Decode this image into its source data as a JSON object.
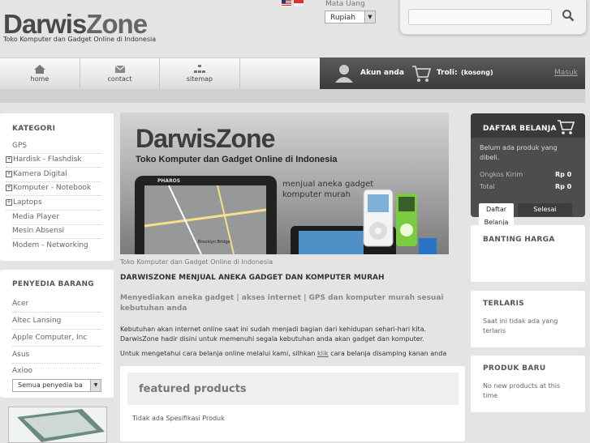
{
  "header": {
    "logo_part1": "Darwis",
    "logo_part2": "Zone",
    "tagline": "Toko Komputer dan Gadget Online di Indonesia",
    "currency_label": "Mata Uang",
    "currency_value": "Rupiah"
  },
  "nav": {
    "items": [
      {
        "label": "home"
      },
      {
        "label": "contact"
      },
      {
        "label": "sitemap"
      }
    ],
    "account_label": "Akun anda",
    "cart_label": "Troli:",
    "cart_value": "(kosong)",
    "login_label": "Masuk"
  },
  "categories": {
    "title": "KATEGORI",
    "items": [
      {
        "label": "GPS",
        "expandable": false
      },
      {
        "label": "Hardisk - Flashdisk",
        "expandable": true
      },
      {
        "label": "Kamera Digital",
        "expandable": true
      },
      {
        "label": "Komputer - Notebook",
        "expandable": true
      },
      {
        "label": "Laptops",
        "expandable": true
      },
      {
        "label": "Media Player",
        "expandable": false
      },
      {
        "label": "Mesin Absensi",
        "expandable": false
      },
      {
        "label": "Modem - Networking",
        "expandable": false
      }
    ]
  },
  "suppliers": {
    "title": "PENYEDIA BARANG",
    "items": [
      "Acer",
      "Altec Lansing",
      "Apple Computer, Inc",
      "Asus",
      "Axioo"
    ],
    "select_value": "Semua penyedia ba"
  },
  "banner": {
    "logo": "DarwisZone",
    "headline": "Toko Komputer dan Gadget Online di Indonesia",
    "tagline_line1": "menjual aneka gadget",
    "tagline_line2": "komputer murah",
    "device_brand": "PHAROS",
    "map_label": "Brooklyn Bridge"
  },
  "main": {
    "caption": "Toko Komputer dan Gadget Online di Indonesia",
    "heading": "DARWISZONE MENJUAL ANEKA GADGET DAN KOMPUTER MURAH",
    "subheading": "Menyediakan aneka gadget | akses internet | GPS dan komputer murah sesuai kebutuhan anda",
    "paragraph1": "Kebutuhan akan internet online saat ini sudah menjadi bagian dari kehidupan sehari-hari kita. DarwisZone hadir disini untuk memenuhi segala kebutuhan anda akan gadget dan komputer.",
    "paragraph2_before": "Untuk mengetahui cara belanja online melalui kami, silhkan ",
    "paragraph2_link": "klik",
    "paragraph2_after": " cara belanja disamping kanan anda",
    "featured_title": "featured products",
    "featured_empty": "Tidak ada Spesifikasi Produk"
  },
  "cart": {
    "title": "DAFTAR BELANJA",
    "empty_text": "Belum ada produk yang dibeli.",
    "shipping_label": "Ongkos Kirim",
    "shipping_value": "Rp 0",
    "total_label": "Total",
    "total_value": "Rp 0",
    "list_button": "Daftar Belanja",
    "checkout_button": "Selesai"
  },
  "price_compare": {
    "title": "BANTING HARGA"
  },
  "bestsellers": {
    "title": "TERLARIS",
    "text": "Saat ini tidak ada yang terlaris"
  },
  "new_products": {
    "title": "PRODUK BARU",
    "text": "No new products at this time"
  }
}
